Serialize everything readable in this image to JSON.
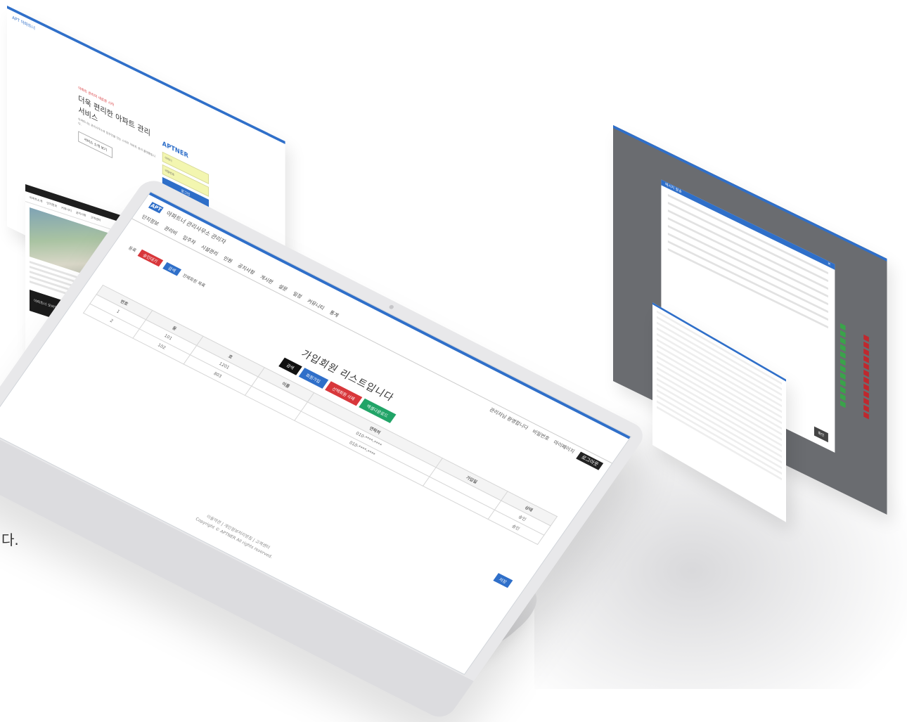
{
  "colors": {
    "accent": "#2f6fc9",
    "danger": "#d8373b",
    "success": "#21a467",
    "dark": "#111111"
  },
  "monitor": {
    "header_logo": "APT",
    "header_title": "아파트너 관리사무소 관리자",
    "nav": [
      "단지정보",
      "관리비",
      "입주자",
      "시설관리",
      "민원",
      "공지사항",
      "게시판",
      "설문",
      "일정",
      "커뮤니티",
      "통계"
    ],
    "util": [
      "관리자님 환영합니다",
      "비밀번호",
      "마이페이지"
    ],
    "logout_label": "로그아웃",
    "title": "가입회원 리스트입니다",
    "buttons": [
      "검색",
      "회원가입",
      "선택회원 삭제",
      "엑셀다운로드"
    ],
    "filter": {
      "left_label": "등록",
      "tag_red": "승인대기",
      "tag_blue": "검색",
      "right_text": "전체회원 목록"
    },
    "table": {
      "headers": [
        "번호",
        "동",
        "호",
        "이름",
        "연락처",
        "가입일",
        "상태"
      ],
      "rows": [
        [
          "1",
          "101",
          "1201",
          "",
          "010-****-****",
          "",
          "승인"
        ],
        [
          "2",
          "102",
          "803",
          "",
          "010-****-****",
          "",
          "승인"
        ]
      ]
    },
    "save_label": "저장",
    "footer_lines": [
      "이용약관 | 개인정보처리방침 | 고객센터",
      "Copyright © APTNER All rights reserved."
    ]
  },
  "login_panel": {
    "brand": "APT 아파트너",
    "hero_tag": "아파트 관리의 새로운 시작",
    "hero_head": "더욱 편리한 아파트 관리서비스",
    "hero_desc": "아파트너는 관리사무소와 입주민을 잇는 스마트 아파트 관리 플랫폼입니다.",
    "hero_button": "서비스 소개 보기",
    "logo": "APTNER",
    "field_id": "아이디",
    "field_pw": "비밀번호",
    "submit": "로그인"
  },
  "site_panel": {
    "nav": [
      "아파트소개",
      "단지정보",
      "커뮤니티",
      "공지사항",
      "고객센터"
    ],
    "banner": "아파트너 모바일 앱"
  },
  "admin_panel": {
    "modal_title": "메시지 발송",
    "close": "×",
    "ok": "확인"
  },
  "fragment_text": "다."
}
